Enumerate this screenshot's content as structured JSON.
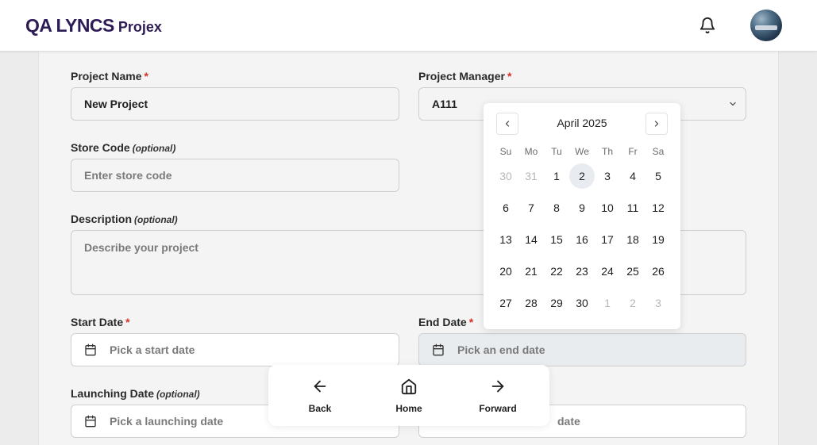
{
  "header": {
    "logo_main": "QA LYNCS",
    "logo_sub": "Projex"
  },
  "form": {
    "project_name": {
      "label": "Project Name",
      "required": "*",
      "value": "New Project"
    },
    "project_manager": {
      "label": "Project Manager",
      "required": "*",
      "value": "A111"
    },
    "store_code": {
      "label": "Store Code",
      "optional": "(optional)",
      "placeholder": "Enter store code"
    },
    "description": {
      "label": "Description",
      "optional": "(optional)",
      "placeholder": "Describe your project"
    },
    "start_date": {
      "label": "Start Date",
      "required": "*",
      "placeholder": "Pick a start date"
    },
    "end_date": {
      "label": "End Date",
      "required": "*",
      "placeholder": "Pick an end date"
    },
    "launching_date": {
      "label": "Launching Date",
      "optional": "(optional)",
      "placeholder": "Pick a launching date"
    },
    "hidden_date": {
      "placeholder_visible": "date"
    }
  },
  "datepicker": {
    "month": "April 2025",
    "weekdays": [
      "Su",
      "Mo",
      "Tu",
      "We",
      "Th",
      "Fr",
      "Sa"
    ],
    "weeks": [
      [
        "30",
        "31",
        "1",
        "2",
        "3",
        "4",
        "5"
      ],
      [
        "6",
        "7",
        "8",
        "9",
        "10",
        "11",
        "12"
      ],
      [
        "13",
        "14",
        "15",
        "16",
        "17",
        "18",
        "19"
      ],
      [
        "20",
        "21",
        "22",
        "23",
        "24",
        "25",
        "26"
      ],
      [
        "27",
        "28",
        "29",
        "30",
        "1",
        "2",
        "3"
      ]
    ],
    "today": "2"
  },
  "bottom_nav": {
    "back": "Back",
    "home": "Home",
    "forward": "Forward"
  },
  "colors": {
    "brand": "#2d1b55",
    "required": "#d93025"
  },
  "icons": [
    "bell-icon",
    "calendar-icon",
    "chevron-left-icon",
    "chevron-right-icon",
    "chevron-down-icon",
    "arrow-left-icon",
    "home-icon",
    "arrow-right-icon"
  ]
}
